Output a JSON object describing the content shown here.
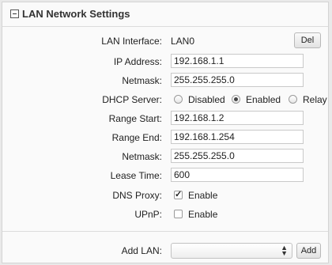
{
  "section": {
    "title": "LAN Network Settings"
  },
  "lan_interface": {
    "label": "LAN Interface:",
    "value": "LAN0",
    "delete_label": "Del"
  },
  "ip_address": {
    "label": "IP Address:",
    "value": "192.168.1.1"
  },
  "netmask": {
    "label": "Netmask:",
    "value": "255.255.255.0"
  },
  "dhcp_server": {
    "label": "DHCP Server:",
    "options": [
      "Disabled",
      "Enabled",
      "Relay"
    ],
    "selected": "Enabled"
  },
  "range_start": {
    "label": "Range Start:",
    "value": "192.168.1.2"
  },
  "range_end": {
    "label": "Range End:",
    "value": "192.168.1.254"
  },
  "dhcp_netmask": {
    "label": "Netmask:",
    "value": "255.255.255.0"
  },
  "lease_time": {
    "label": "Lease Time:",
    "value": "600"
  },
  "dns_proxy": {
    "label": "DNS Proxy:",
    "option_label": "Enable",
    "checked": true
  },
  "upnp": {
    "label": "UPnP:",
    "option_label": "Enable",
    "checked": false
  },
  "add_lan": {
    "label": "Add LAN:",
    "selected": "",
    "add_label": "Add"
  }
}
